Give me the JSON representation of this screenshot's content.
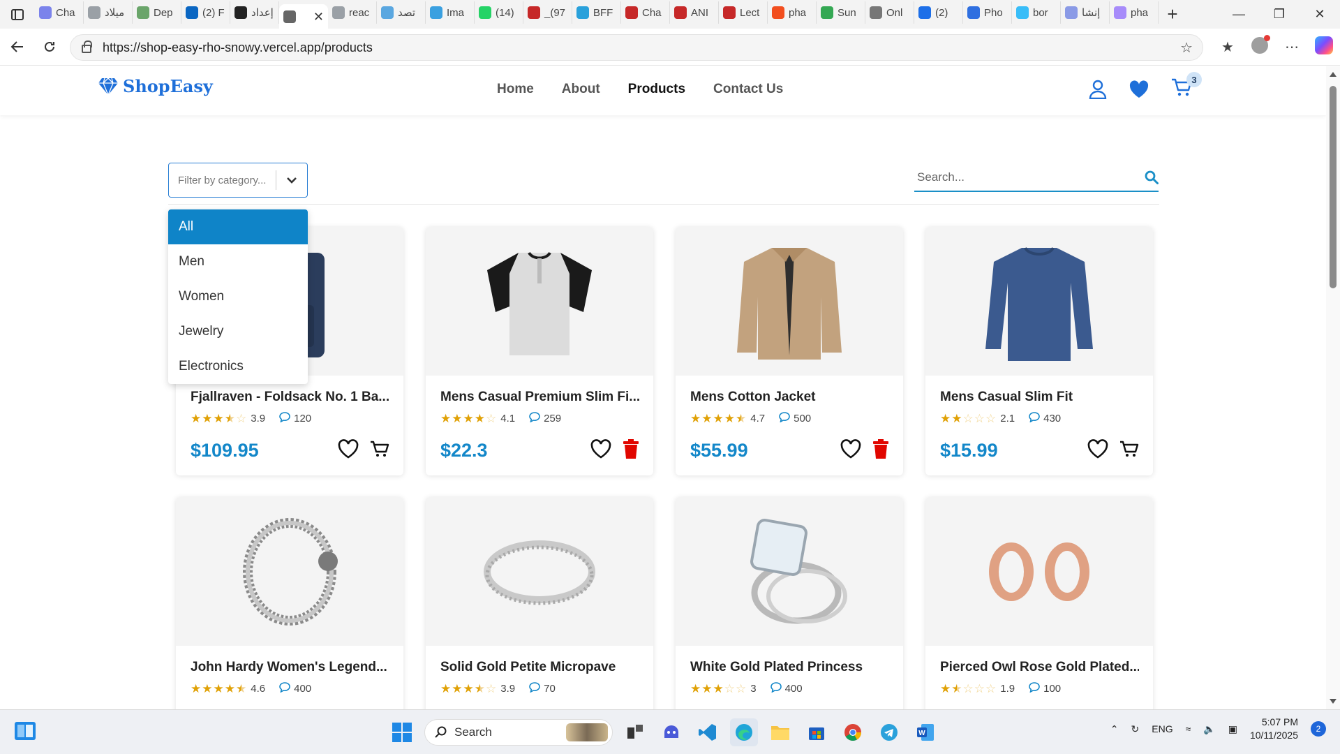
{
  "browser": {
    "tabs": [
      {
        "label": "Cha",
        "color": "#7b83eb"
      },
      {
        "label": "ميلاد",
        "color": "#9aa0a6"
      },
      {
        "label": "Dep",
        "color": "#6aa56a"
      },
      {
        "label": "(2) F",
        "color": "#0a66c2"
      },
      {
        "label": "إعداد",
        "color": "#222222"
      },
      {
        "label": "",
        "color": "#666666",
        "active": true
      },
      {
        "label": "reac",
        "color": "#9aa0a6"
      },
      {
        "label": "تصد",
        "color": "#5aa7e0"
      },
      {
        "label": "Ima",
        "color": "#3aa0e0"
      },
      {
        "label": "(14)",
        "color": "#25d366"
      },
      {
        "label": "_(97",
        "color": "#c62828"
      },
      {
        "label": "BFF",
        "color": "#2aa1db"
      },
      {
        "label": "Cha",
        "color": "#c62828"
      },
      {
        "label": "ANI",
        "color": "#c62828"
      },
      {
        "label": "Lect",
        "color": "#c62828"
      },
      {
        "label": "pha",
        "color": "#f24e1e"
      },
      {
        "label": "Sun",
        "color": "#34a853"
      },
      {
        "label": "Onl",
        "color": "#777777"
      },
      {
        "label": "(2)",
        "color": "#1d6fe8"
      },
      {
        "label": "Pho",
        "color": "#2f6fe0"
      },
      {
        "label": "bor",
        "color": "#38bdf8"
      },
      {
        "label": "إنشا",
        "color": "#8a9ae6"
      },
      {
        "label": "pha",
        "color": "#a78bfa"
      }
    ],
    "url": "https://shop-easy-rho-snowy.vercel.app/products"
  },
  "site": {
    "brand": "ShopEasy",
    "nav": [
      "Home",
      "About",
      "Products",
      "Contact Us"
    ],
    "active_nav": "Products",
    "cart_count": "3",
    "accent": "#1387c9",
    "brand_color": "#1e6fd9"
  },
  "filter": {
    "placeholder": "Filter by category...",
    "options": [
      "All",
      "Men",
      "Women",
      "Jewelry",
      "Electronics"
    ],
    "selected": "All"
  },
  "search": {
    "placeholder": "Search..."
  },
  "products": [
    {
      "title": "Fjallraven - Foldsack No. 1 Ba...",
      "rating": "3.9",
      "reviews": "120",
      "price": "$109.95",
      "action": "cart",
      "image": "backpack"
    },
    {
      "title": "Mens Casual Premium Slim Fi...",
      "rating": "4.1",
      "reviews": "259",
      "price": "$22.3",
      "action": "delete",
      "image": "henley-tshirt"
    },
    {
      "title": "Mens Cotton Jacket",
      "rating": "4.7",
      "reviews": "500",
      "price": "$55.99",
      "action": "delete",
      "image": "cotton-jacket"
    },
    {
      "title": "Mens Casual Slim Fit",
      "rating": "2.1",
      "reviews": "430",
      "price": "$15.99",
      "action": "cart",
      "image": "long-sleeve-shirt"
    },
    {
      "title": "John Hardy Women's Legend...",
      "rating": "4.6",
      "reviews": "400",
      "price": "",
      "action": "cart",
      "image": "dragon-bracelet"
    },
    {
      "title": "Solid Gold Petite Micropave",
      "rating": "3.9",
      "reviews": "70",
      "price": "",
      "action": "cart",
      "image": "silver-ring"
    },
    {
      "title": "White Gold Plated Princess",
      "rating": "3",
      "reviews": "400",
      "price": "",
      "action": "cart",
      "image": "princess-ring"
    },
    {
      "title": "Pierced Owl Rose Gold Plated...",
      "rating": "1.9",
      "reviews": "100",
      "price": "",
      "action": "cart",
      "image": "rose-gold-plugs"
    }
  ],
  "taskbar": {
    "search_label": "Search",
    "language": "ENG",
    "time": "5:07 PM",
    "date": "10/11/2025",
    "notifications": "2"
  }
}
